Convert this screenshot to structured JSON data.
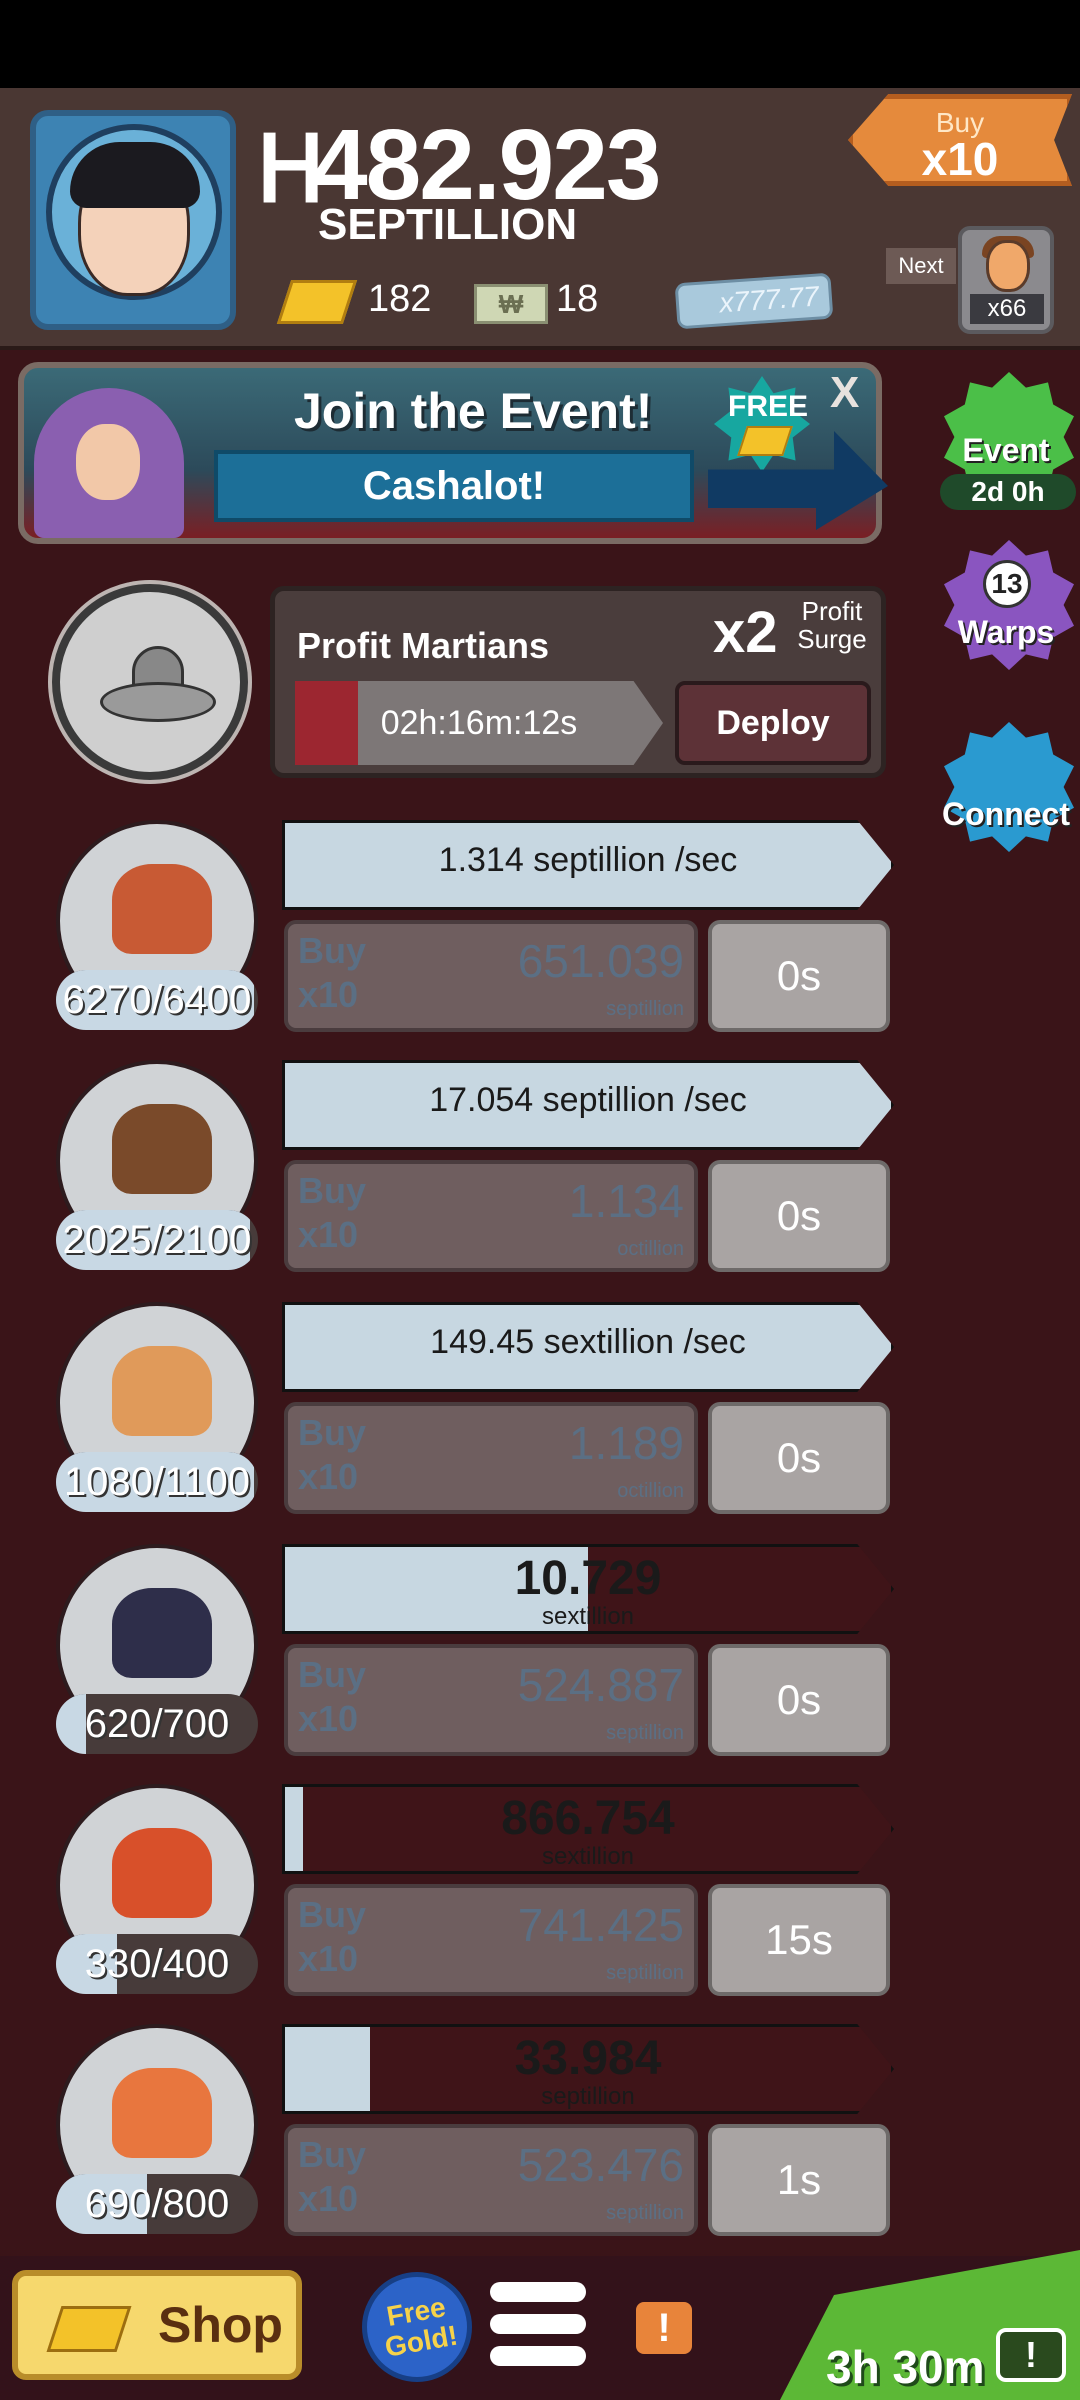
{
  "header": {
    "money_symbol": "ᕼ",
    "money_value": "482.923",
    "money_unit": "SEPTILLION",
    "gold_count": "182",
    "megabucks_count": "18",
    "multiplier_tag": "x777.77",
    "buy_label": "Buy",
    "buy_amount": "x10",
    "next_label": "Next",
    "next_count": "x66"
  },
  "event_banner": {
    "title": "Join the Event!",
    "subtitle": "Cashalot!",
    "free_label": "FREE",
    "close": "X"
  },
  "side_buttons": {
    "event_label": "Event",
    "event_timer": "2d 0h",
    "warps_count": "13",
    "warps_label": "Warps",
    "connect_label": "Connect"
  },
  "manager": {
    "name": "Profit Martians",
    "multiplier": "x2",
    "surge_label": "Profit Surge",
    "timer": "02h:16m:12s",
    "timer_progress": 0.17,
    "deploy_label": "Deploy"
  },
  "businesses": [
    {
      "count": "6270/6400",
      "count_progress": 0.98,
      "rate_text": "1.314 septillion /sec",
      "rate_progress": 1.0,
      "buy_line1": "Buy",
      "buy_line2": "x10",
      "cost": "651.039",
      "cost_unit": "septillion",
      "time": "0s"
    },
    {
      "count": "2025/2100",
      "count_progress": 0.96,
      "rate_text": "17.054 septillion /sec",
      "rate_progress": 1.0,
      "buy_line1": "Buy",
      "buy_line2": "x10",
      "cost": "1.134",
      "cost_unit": "octillion",
      "time": "0s"
    },
    {
      "count": "1080/1100",
      "count_progress": 0.98,
      "rate_text": "149.45 sextillion /sec",
      "rate_progress": 1.0,
      "buy_line1": "Buy",
      "buy_line2": "x10",
      "cost": "1.189",
      "cost_unit": "octillion",
      "time": "0s"
    },
    {
      "count": "620/700",
      "count_progress": 0.15,
      "rate_value": "10.729",
      "rate_unit": "sextillion",
      "rate_progress": 0.5,
      "buy_line1": "Buy",
      "buy_line2": "x10",
      "cost": "524.887",
      "cost_unit": "septillion",
      "time": "0s"
    },
    {
      "count": "330/400",
      "count_progress": 0.3,
      "rate_value": "866.754",
      "rate_unit": "sextillion",
      "rate_progress": 0.03,
      "buy_line1": "Buy",
      "buy_line2": "x10",
      "cost": "741.425",
      "cost_unit": "septillion",
      "time": "15s"
    },
    {
      "count": "690/800",
      "count_progress": 0.45,
      "rate_value": "33.984",
      "rate_unit": "septillion",
      "rate_progress": 0.14,
      "buy_line1": "Buy",
      "buy_line2": "x10",
      "cost": "523.476",
      "cost_unit": "septillion",
      "time": "1s"
    }
  ],
  "bottom_bar": {
    "shop_label": "Shop",
    "free_gold_label": "Free Gold!",
    "alert": "!",
    "tv_timer": "3h 30m",
    "tv_alert": "!"
  }
}
